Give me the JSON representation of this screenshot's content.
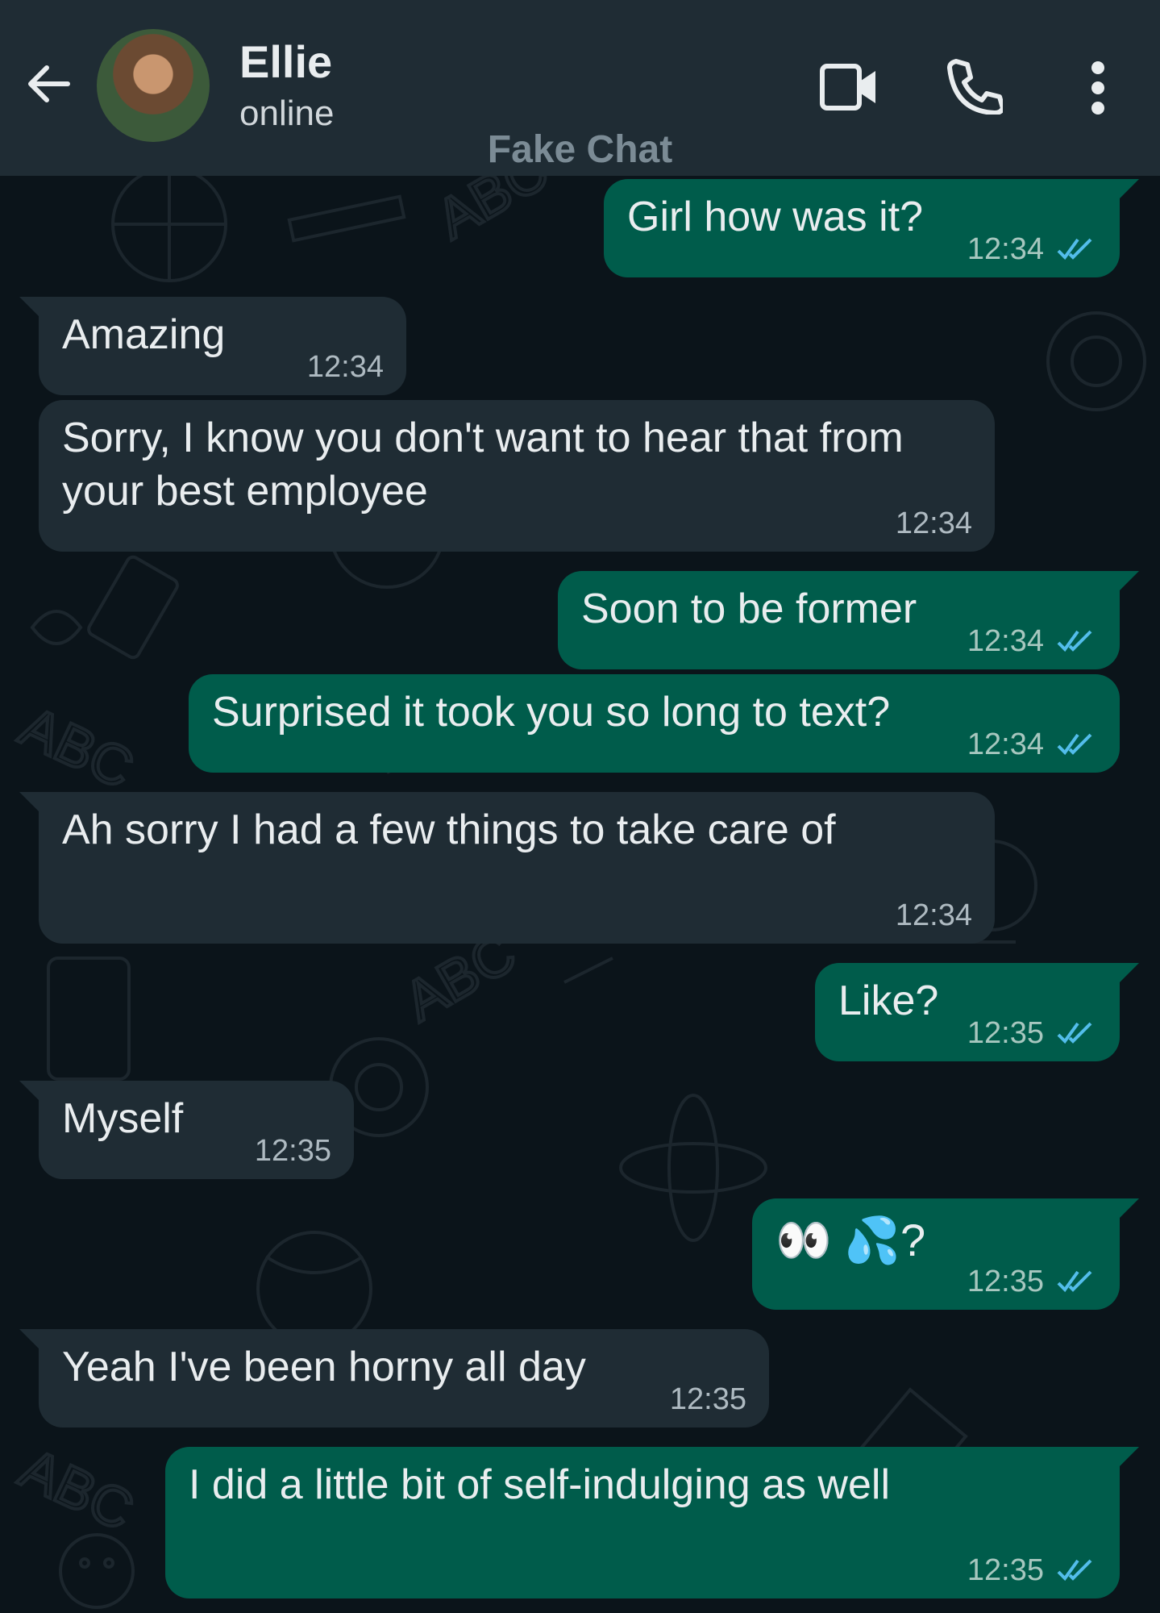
{
  "header": {
    "contact_name": "Ellie",
    "contact_status": "online",
    "watermark": "Fake Chat"
  },
  "icons": {
    "back": "arrow-left-icon",
    "video": "video-call-icon",
    "phone": "phone-icon",
    "menu": "more-vert-icon"
  },
  "colors": {
    "header_bg": "#1f2c34",
    "chat_bg": "#0b141a",
    "incoming_bubble": "#1f2c34",
    "outgoing_bubble": "#005c4b",
    "read_tick": "#53bdeb"
  },
  "messages": [
    {
      "dir": "out",
      "text": "Girl how was it?",
      "time": "12:34",
      "read": true
    },
    {
      "dir": "in",
      "text": "Amazing",
      "time": "12:34"
    },
    {
      "dir": "in",
      "text": "Sorry, I know you don't want to hear that from your best employee",
      "time": "12:34"
    },
    {
      "dir": "out",
      "text": "Soon to be former",
      "time": "12:34",
      "read": true
    },
    {
      "dir": "out",
      "text": "Surprised it took you so long to text?",
      "time": "12:34",
      "read": true
    },
    {
      "dir": "in",
      "text": "Ah sorry I had a few things to take care of",
      "time": "12:34"
    },
    {
      "dir": "out",
      "text": "Like?",
      "time": "12:35",
      "read": true
    },
    {
      "dir": "in",
      "text": "Myself",
      "time": "12:35"
    },
    {
      "dir": "out",
      "text": "👀 💦?",
      "time": "12:35",
      "read": true
    },
    {
      "dir": "in",
      "text": "Yeah I've been horny all day",
      "time": "12:35"
    },
    {
      "dir": "out",
      "text": "I did a little bit of self-indulging as well",
      "time": "12:35",
      "read": true
    }
  ]
}
